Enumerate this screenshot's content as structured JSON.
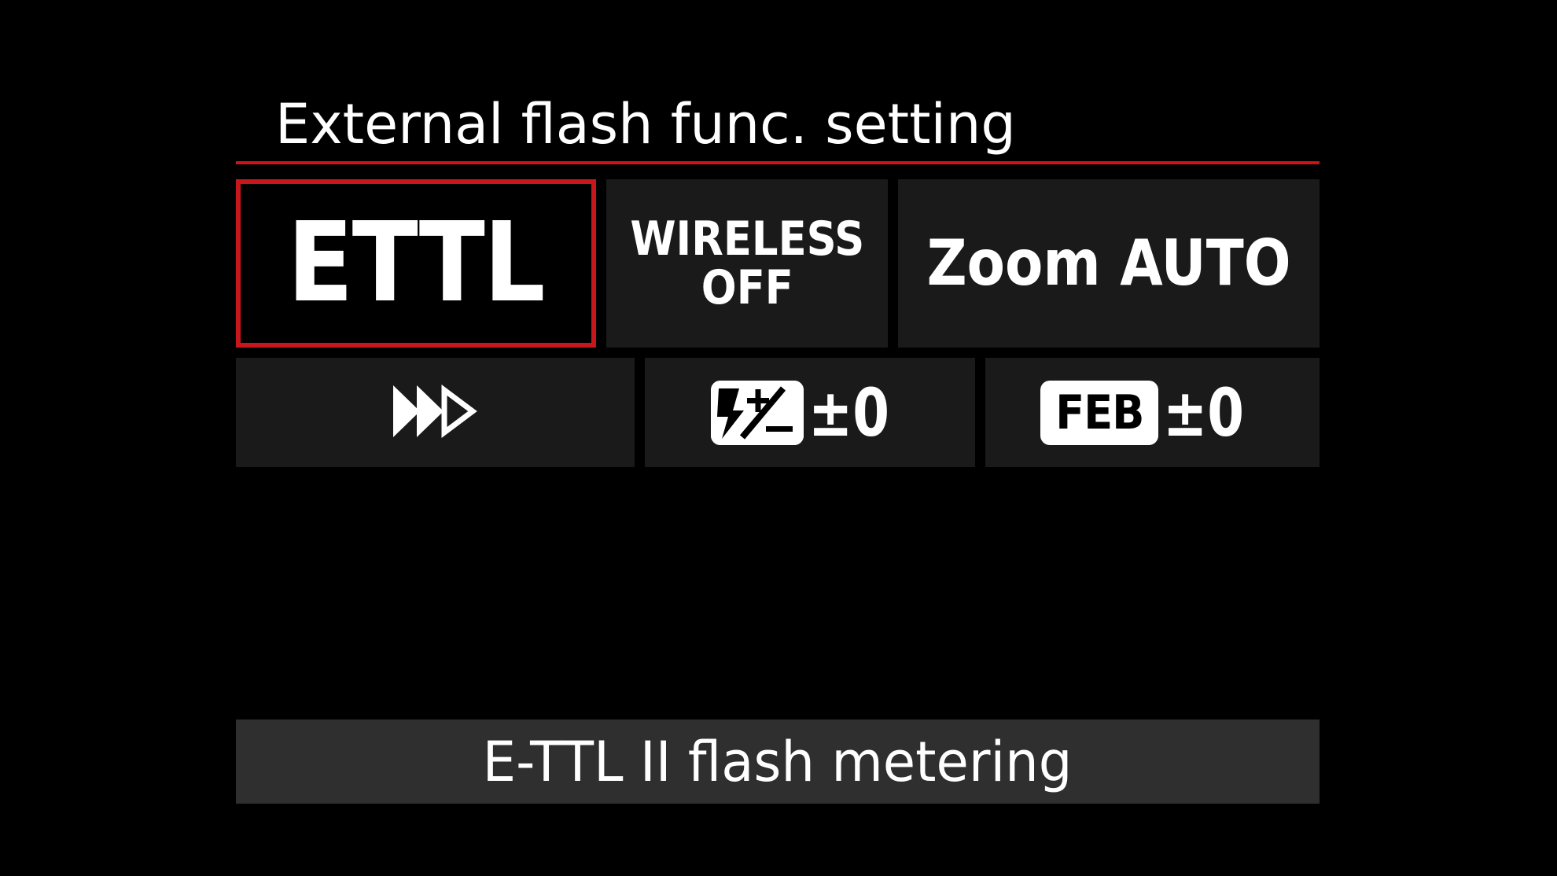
{
  "header": {
    "title": "External flash func. setting"
  },
  "row1": {
    "flash_mode": {
      "label": "ETTL",
      "selected": true
    },
    "wireless": {
      "line1": "WIRELESS",
      "line2": "OFF"
    },
    "zoom": {
      "label": "Zoom AUTO"
    }
  },
  "row2": {
    "sync": {
      "icon": "high-speed-sync-icon"
    },
    "flash_exposure_comp": {
      "icon": "flash-exposure-comp-icon",
      "value": "±0"
    },
    "feb": {
      "badge": "FEB",
      "value": "±0"
    }
  },
  "footer": {
    "description": "E-TTL II flash metering"
  },
  "colors": {
    "accent": "#c8161d",
    "cell_bg": "#1a1a1a",
    "footer_bg": "#2f2f2f",
    "background": "#000000",
    "text": "#ffffff"
  }
}
